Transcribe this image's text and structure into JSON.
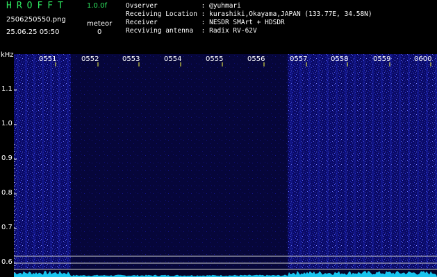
{
  "header": {
    "app_title": "HROFFT",
    "version": "1.0.0f",
    "filename": "2506250550.png",
    "datetime": "25.06.25 05:50",
    "meteor_label": "meteor",
    "meteor_count": "0"
  },
  "station_info": [
    "Ovserver           : @yuhmari",
    "Receiving Location : kurashiki,Okayama,JAPAN (133.77E, 34.58N)",
    "Receiver           : NESDR SMArt + HDSDR",
    "Recviving antenna  : Radix RV-62V"
  ],
  "axis": {
    "y_unit": "kHz",
    "y_ticks": [
      "1.1",
      "1.0",
      "0.9",
      "0.8",
      "0.7",
      "0.6"
    ],
    "x_ticks": [
      "0551",
      "0552",
      "0553",
      "0554",
      "0555",
      "0556",
      "0557",
      "0558",
      "0559",
      "0600"
    ]
  },
  "colors": {
    "background": "#000000",
    "title_green": "#2ee860",
    "noise_blue": "#3440d8",
    "signal_cyan": "#19c4ee",
    "grid_line": "#ffffff"
  }
}
